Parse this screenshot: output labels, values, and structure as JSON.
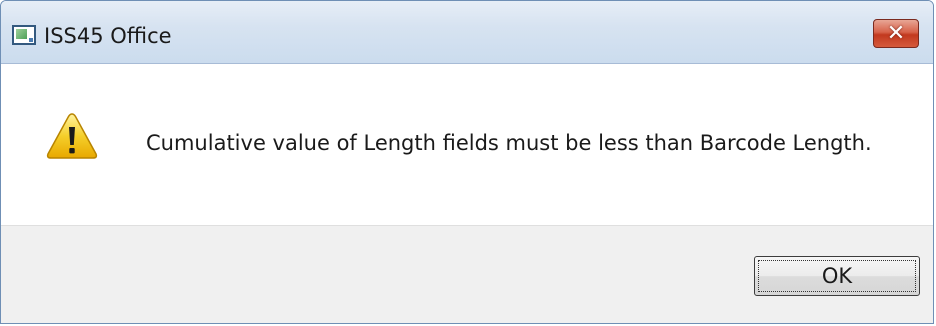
{
  "window": {
    "title": "ISS45 Office",
    "close_icon": "close-x-icon",
    "app_icon": "application-window-icon"
  },
  "dialog": {
    "icon": "warning-icon",
    "message": "Cumulative value of Length fields must be less than Barcode Length."
  },
  "buttons": {
    "ok_label": "OK"
  },
  "colors": {
    "close_button": "#c2391f",
    "titlebar": "#d7e3f1",
    "warning": "#f2c200",
    "footer": "#f0f0f0"
  }
}
